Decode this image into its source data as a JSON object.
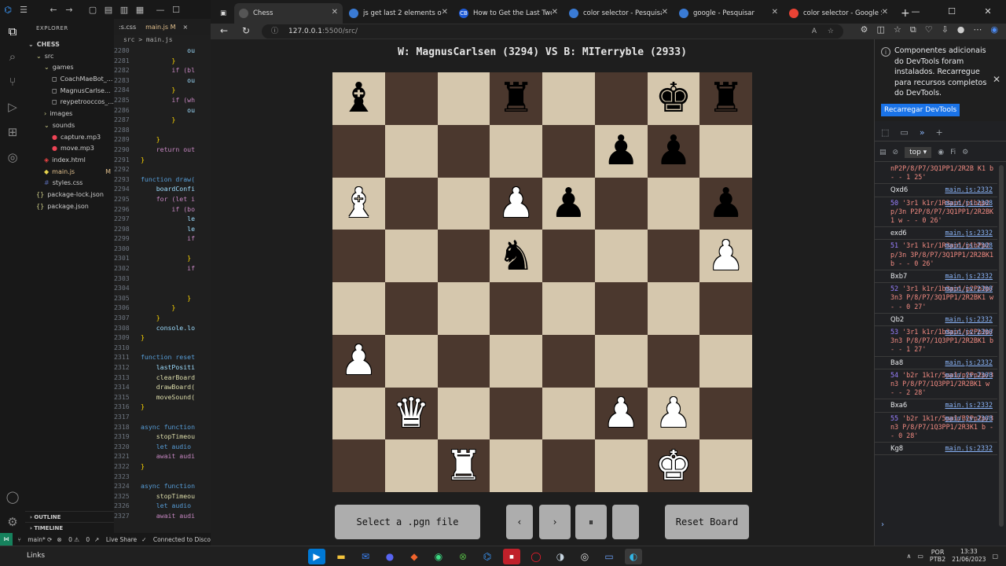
{
  "vscode": {
    "tabs": [
      ":s.css",
      "main.js",
      "M"
    ],
    "breadcrumb": "src > main.js",
    "explorer_title": "EXPLORER",
    "explorer_items": [
      {
        "label": "CHESS",
        "indent": 0,
        "type": "root"
      },
      {
        "label": "src",
        "indent": 1,
        "type": "folder-open"
      },
      {
        "label": "games",
        "indent": 2,
        "type": "folder-open"
      },
      {
        "label": "CoachMaeBot_...",
        "indent": 3,
        "type": "file"
      },
      {
        "label": "MagnusCarlse...",
        "indent": 3,
        "type": "file"
      },
      {
        "label": "reypetrooccos_...",
        "indent": 3,
        "type": "file"
      },
      {
        "label": "images",
        "indent": 2,
        "type": "folder"
      },
      {
        "label": "sounds",
        "indent": 2,
        "type": "folder-open"
      },
      {
        "label": "capture.mp3",
        "indent": 3,
        "type": "audio"
      },
      {
        "label": "move.mp3",
        "indent": 3,
        "type": "audio"
      },
      {
        "label": "index.html",
        "indent": 2,
        "type": "html"
      },
      {
        "label": "main.js",
        "indent": 2,
        "type": "js",
        "mark": "M"
      },
      {
        "label": "styles.css",
        "indent": 2,
        "type": "css"
      },
      {
        "label": "package-lock.json",
        "indent": 1,
        "type": "json"
      },
      {
        "label": "package.json",
        "indent": 1,
        "type": "json"
      }
    ],
    "outline": "OUTLINE",
    "timeline": "TIMELINE",
    "code_lines": [
      {
        "n": "2280",
        "t": "            ou",
        "c": "vr"
      },
      {
        "n": "2281",
        "t": "        }",
        "c": "br"
      },
      {
        "n": "2282",
        "t": "        if (bl",
        "c": "ctl"
      },
      {
        "n": "2283",
        "t": "            ou",
        "c": "vr"
      },
      {
        "n": "2284",
        "t": "        }",
        "c": "br"
      },
      {
        "n": "2285",
        "t": "        if (wh",
        "c": "ctl"
      },
      {
        "n": "2286",
        "t": "            ou",
        "c": "vr"
      },
      {
        "n": "2287",
        "t": "        }",
        "c": "br"
      },
      {
        "n": "2288",
        "t": "",
        "c": "pl"
      },
      {
        "n": "2289",
        "t": "    }",
        "c": "br"
      },
      {
        "n": "2290",
        "t": "    return out",
        "c": "ctl"
      },
      {
        "n": "2291",
        "t": "}",
        "c": "br"
      },
      {
        "n": "2292",
        "t": "",
        "c": "pl"
      },
      {
        "n": "2293",
        "t": "function draw(",
        "c": "kw"
      },
      {
        "n": "2294",
        "t": "    boardConfi",
        "c": "vr"
      },
      {
        "n": "2295",
        "t": "    for (let i",
        "c": "ctl"
      },
      {
        "n": "2296",
        "t": "        if (bo",
        "c": "ctl"
      },
      {
        "n": "2297",
        "t": "            le",
        "c": "vr"
      },
      {
        "n": "2298",
        "t": "            le",
        "c": "vr"
      },
      {
        "n": "2299",
        "t": "            if",
        "c": "ctl"
      },
      {
        "n": "2300",
        "t": "",
        "c": "pl"
      },
      {
        "n": "2301",
        "t": "            }",
        "c": "br"
      },
      {
        "n": "2302",
        "t": "            if",
        "c": "ctl"
      },
      {
        "n": "2303",
        "t": "",
        "c": "pl"
      },
      {
        "n": "2304",
        "t": "",
        "c": "pl"
      },
      {
        "n": "2305",
        "t": "            }",
        "c": "br"
      },
      {
        "n": "2306",
        "t": "        }",
        "c": "br"
      },
      {
        "n": "2307",
        "t": "    }",
        "c": "br"
      },
      {
        "n": "2308",
        "t": "    console.lo",
        "c": "vr"
      },
      {
        "n": "2309",
        "t": "}",
        "c": "br"
      },
      {
        "n": "2310",
        "t": "",
        "c": "pl"
      },
      {
        "n": "2311",
        "t": "function reset",
        "c": "kw"
      },
      {
        "n": "2312",
        "t": "    lastPositi",
        "c": "vr"
      },
      {
        "n": "2313",
        "t": "    clearBoard",
        "c": "fn"
      },
      {
        "n": "2314",
        "t": "    drawBoard(",
        "c": "fn"
      },
      {
        "n": "2315",
        "t": "    moveSound(",
        "c": "fn"
      },
      {
        "n": "2316",
        "t": "}",
        "c": "br"
      },
      {
        "n": "2317",
        "t": "",
        "c": "pl"
      },
      {
        "n": "2318",
        "t": "async function",
        "c": "kw"
      },
      {
        "n": "2319",
        "t": "    stopTimeou",
        "c": "fn"
      },
      {
        "n": "2320",
        "t": "    let audio",
        "c": "kw"
      },
      {
        "n": "2321",
        "t": "    await audi",
        "c": "ctl"
      },
      {
        "n": "2322",
        "t": "}",
        "c": "br"
      },
      {
        "n": "2323",
        "t": "",
        "c": "pl"
      },
      {
        "n": "2324",
        "t": "async function",
        "c": "kw"
      },
      {
        "n": "2325",
        "t": "    stopTimeou",
        "c": "fn"
      },
      {
        "n": "2326",
        "t": "    let audio",
        "c": "kw"
      },
      {
        "n": "2327",
        "t": "    await audi",
        "c": "ctl"
      }
    ],
    "status": {
      "branch": "main*",
      "errors": "0",
      "warnings": "0",
      "live_share": "Live Share",
      "connected": "Connected to Disco"
    }
  },
  "browser": {
    "tabs": [
      {
        "title": "Chess",
        "fav_color": "#555555",
        "fav": ""
      },
      {
        "title": "js get last 2 elements of str",
        "fav_color": "#3a7bd5",
        "fav": ""
      },
      {
        "title": "How to Get the Last Two Ch",
        "fav_color": "#1e5bd8",
        "fav": "CB"
      },
      {
        "title": "color selector - Pesquisar",
        "fav_color": "#3a7bd5",
        "fav": ""
      },
      {
        "title": "google - Pesquisar",
        "fav_color": "#3a7bd5",
        "fav": ""
      },
      {
        "title": "color selector - Google Sea",
        "fav_color": "#ea4335",
        "fav": ""
      }
    ],
    "url_host": "127.0.0.1",
    "url_path": ":5500/src/"
  },
  "game": {
    "title": "W: MagnusCarlsen (3294) VS B: MITerryble (2933)",
    "board": [
      [
        "bB",
        "",
        "",
        "bR",
        "",
        "",
        "bK",
        "bR"
      ],
      [
        "",
        "",
        "",
        "",
        "",
        "bP",
        "bP",
        ""
      ],
      [
        "wB",
        "",
        "",
        "wP",
        "bP",
        "",
        "",
        "bP"
      ],
      [
        "",
        "",
        "",
        "bN",
        "",
        "",
        "",
        "wP"
      ],
      [
        "",
        "",
        "",
        "",
        "",
        "",
        "",
        ""
      ],
      [
        "wP",
        "",
        "",
        "",
        "",
        "",
        "",
        ""
      ],
      [
        "",
        "wQ",
        "",
        "",
        "",
        "wP",
        "wP",
        ""
      ],
      [
        "",
        "",
        "wR",
        "",
        "",
        "",
        "wK",
        ""
      ]
    ],
    "colors": {
      "light": "#d5c7ad",
      "dark": "#4b382e"
    },
    "buttons": {
      "select": "Select a .pgn file",
      "prev": "‹",
      "next": "›",
      "pause": "⏸",
      "play": "",
      "reset": "Reset Board"
    }
  },
  "devtools": {
    "notice": "Componentes adicionais do DevTools foram instalados. Recarregue para recursos completos do DevTools.",
    "reload": "Recarregar DevTools",
    "context": "top",
    "filter": "Fi",
    "first_str": "nP2P/8/P7/3Q1PP1/2R2B K1 b - - 1 25'",
    "entries": [
      {
        "move": "Qxd6",
        "src": "main.js:2332"
      },
      {
        "num": "50",
        "str": "'3r1 k1r/1R3pp1/p1bqp2p/3n P2P/8/P7/3Q1PP1/2R2BK 1 w - - 0 26'",
        "src": "main.js:2308"
      },
      {
        "move": "exd6",
        "src": "main.js:2332"
      },
      {
        "num": "51",
        "str": "'3r1 k1r/1R3pp1/p1bPp2p/3n 3P/8/P7/3Q1PP1/2R2BK1 b - - 0 26'",
        "src": "main.js:2308"
      },
      {
        "move": "Bxb7",
        "src": "main.js:2332"
      },
      {
        "num": "52",
        "str": "'3r1 k1r/1b3pp1/p2Pp2p/3n3 P/8/P7/3Q1PP1/2R2BK1 w - - 0 27'",
        "src": "main.js:2308"
      },
      {
        "move": "Qb2",
        "src": "main.js:2332"
      },
      {
        "num": "53",
        "str": "'3r1 k1r/1b3pp1/p2Pp2p/3n3 P/8/P7/1Q3PP1/2R2BK1 b - - 1 27'",
        "src": "main.js:2308"
      },
      {
        "move": "Ba8",
        "src": "main.js:2332"
      },
      {
        "num": "54",
        "str": "'b2r 1k1r/5pp1/p2Pp2p/3n3 P/8/P7/1Q3PP1/2R2BK1 w - - 2 28'",
        "src": "main.js:2308"
      },
      {
        "move": "Bxa6",
        "src": "main.js:2332"
      },
      {
        "num": "55",
        "str": "'b2r 1k1r/5pp1/B2Pp2p/3n3 P/8/P7/1Q3PP1/2R3K1 b - - 0 28'",
        "src": "main.js:2308"
      },
      {
        "move": "Kg8",
        "src": "main.js:2332"
      }
    ]
  },
  "taskbar": {
    "label": "Links",
    "lang": "POR",
    "layout": "PTB2",
    "time": "13:33",
    "date": "21/06/2023"
  }
}
